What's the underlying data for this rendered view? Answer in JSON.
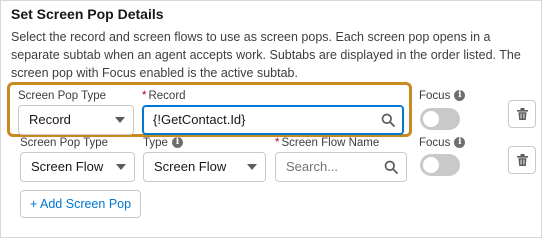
{
  "section": {
    "title": "Set Screen Pop Details",
    "description": "Select the record and screen flows to use as screen pops. Each screen pop opens in a separate subtab when an agent accepts work. Subtabs are displayed in the order listed. The screen pop with Focus enabled is the active subtab."
  },
  "rows": [
    {
      "type_label": "Screen Pop Type",
      "type_value": "Record",
      "record_label": "Record",
      "record_required_mark": "*",
      "record_value": "{!GetContact.Id}",
      "focus_label": "Focus",
      "focus_on": false
    },
    {
      "type_label": "Screen Pop Type",
      "type_value": "Screen Flow",
      "subtype_label": "Type",
      "subtype_value": "Screen Flow",
      "flow_label": "Screen Flow Name",
      "flow_required_mark": "*",
      "flow_placeholder": "Search...",
      "focus_label": "Focus",
      "focus_on": false
    }
  ],
  "add_button_label": "+ Add Screen Pop",
  "colors": {
    "accent": "#0176d3",
    "highlight_border": "#c8891f",
    "required": "#ba0517"
  },
  "icons": [
    "info-icon",
    "chevron-down-icon",
    "search-icon",
    "trash-icon"
  ]
}
